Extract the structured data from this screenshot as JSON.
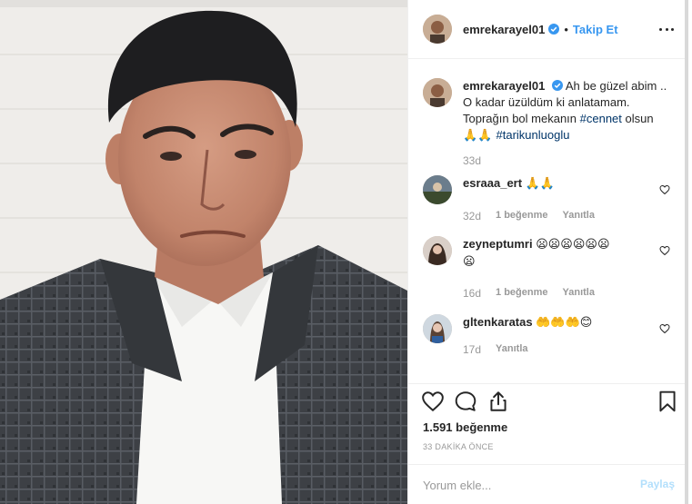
{
  "post": {
    "author": "emrekarayel01",
    "follow_label": "Takip Et",
    "separator": "•"
  },
  "caption": {
    "author": "emrekarayel01",
    "text_line1": "Ah be güzel abim ..",
    "text_line2": "O kadar üzüldüm ki anlatamam.",
    "text_line3_prefix": "Toprağın bol mekanın ",
    "hashtag1": "#cennet",
    "text_line3_suffix": " olsun",
    "emoji": "🙏🙏 ",
    "hashtag2": "#tarikunluoglu",
    "time": "33d"
  },
  "comments": [
    {
      "user": "esraaa_ert",
      "text": "🙏🙏",
      "time": "32d",
      "likes": "1 beğenme",
      "reply": "Yanıtla"
    },
    {
      "user": "zeyneptumri",
      "text": "😦😦😦😦😦😦",
      "text2": "😦",
      "time": "16d",
      "likes": "1 beğenme",
      "reply": "Yanıtla"
    },
    {
      "user": "gltenkaratas",
      "text": "🤲🤲🤲😊",
      "time": "17d",
      "reply": "Yanıtla"
    }
  ],
  "actions": {
    "likes_count": "1.591 beğenme",
    "time_ago": "33 DAKİKA ÖNCE",
    "comment_placeholder": "Yorum ekle...",
    "post_label": "Paylaş"
  },
  "icons": {
    "verified": "verified-badge-icon",
    "more": "more-options-icon",
    "like": "heart-icon",
    "comment": "comment-bubble-icon",
    "share": "share-icon",
    "save": "bookmark-icon"
  },
  "colors": {
    "link": "#3897f0",
    "hashtag": "#003569",
    "muted": "#999999",
    "text": "#262626",
    "border": "#efefef"
  }
}
